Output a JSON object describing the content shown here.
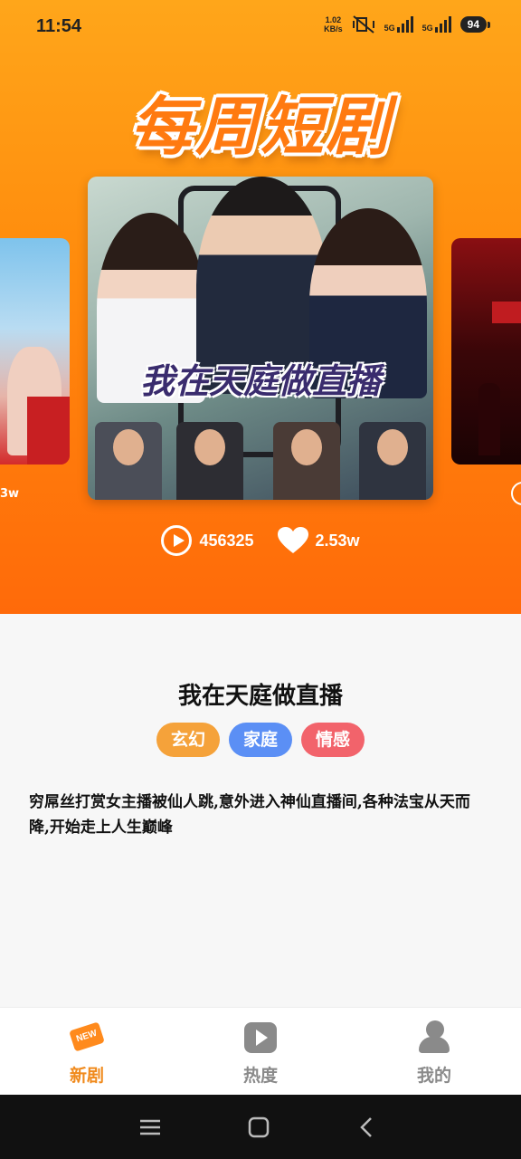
{
  "status_bar": {
    "time": "11:54",
    "net_speed_value": "1.02",
    "net_speed_unit": "KB/s",
    "sig1_label": "5G",
    "sig2_label": "5G",
    "battery": "94"
  },
  "banner": {
    "title": "每周短剧"
  },
  "carousel": {
    "main_poster_title": "我在天庭做直播",
    "left_card_stat": "3w"
  },
  "stats": {
    "plays": "456325",
    "likes": "2.53w"
  },
  "drama": {
    "title": "我在天庭做直播",
    "tags": [
      {
        "label": "玄幻",
        "color": "#f5a23a"
      },
      {
        "label": "家庭",
        "color": "#5b8ff5"
      },
      {
        "label": "情感",
        "color": "#f2636b"
      }
    ],
    "description": "穷屌丝打赏女主播被仙人跳,意外进入神仙直播间,各种法宝从天而降,开始走上人生巅峰"
  },
  "tabbar": {
    "items": [
      {
        "label": "新剧",
        "active": true,
        "badge": "NEW"
      },
      {
        "label": "热度",
        "active": false
      },
      {
        "label": "我的",
        "active": false
      }
    ],
    "active_color": "#f08a1c",
    "inactive_color": "#8a8a8a"
  }
}
